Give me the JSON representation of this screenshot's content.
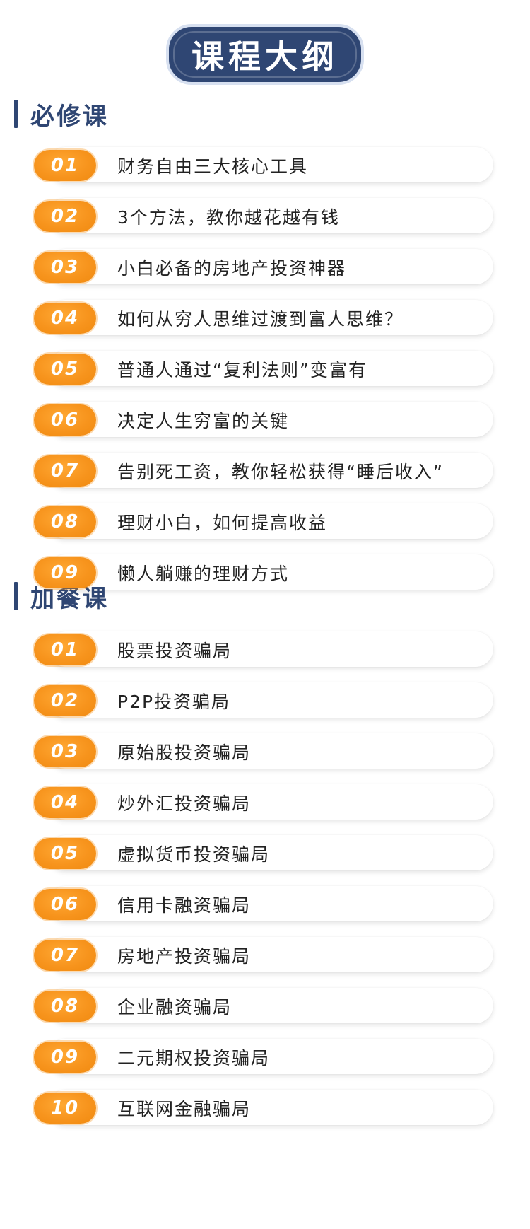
{
  "header": {
    "title": "课程大纲"
  },
  "colors": {
    "navy": "#2f4673",
    "orange": "#f7941d",
    "text": "#222222"
  },
  "required_section": {
    "title": "必修课",
    "items": [
      {
        "number": "01",
        "label": "财务自由三大核心工具"
      },
      {
        "number": "02",
        "label": "3个方法，教你越花越有钱"
      },
      {
        "number": "03",
        "label": "小白必备的房地产投资神器"
      },
      {
        "number": "04",
        "label": "如何从穷人思维过渡到富人思维？"
      },
      {
        "number": "05",
        "label": "普通人通过“复利法则”变富有"
      },
      {
        "number": "06",
        "label": "决定人生穷富的关键"
      },
      {
        "number": "07",
        "label": "告别死工资，教你轻松获得“睡后收入”"
      },
      {
        "number": "08",
        "label": "理财小白，如何提高收益"
      },
      {
        "number": "09",
        "label": "懒人躺赚的理财方式"
      }
    ]
  },
  "bonus_section": {
    "title": "加餐课",
    "items": [
      {
        "number": "01",
        "label": "股票投资骗局"
      },
      {
        "number": "02",
        "label": "P2P投资骗局"
      },
      {
        "number": "03",
        "label": "原始股投资骗局"
      },
      {
        "number": "04",
        "label": "炒外汇投资骗局"
      },
      {
        "number": "05",
        "label": "虚拟货币投资骗局"
      },
      {
        "number": "06",
        "label": "信用卡融资骗局"
      },
      {
        "number": "07",
        "label": "房地产投资骗局"
      },
      {
        "number": "08",
        "label": "企业融资骗局"
      },
      {
        "number": "09",
        "label": "二元期权投资骗局"
      },
      {
        "number": "10",
        "label": "互联网金融骗局"
      }
    ]
  }
}
